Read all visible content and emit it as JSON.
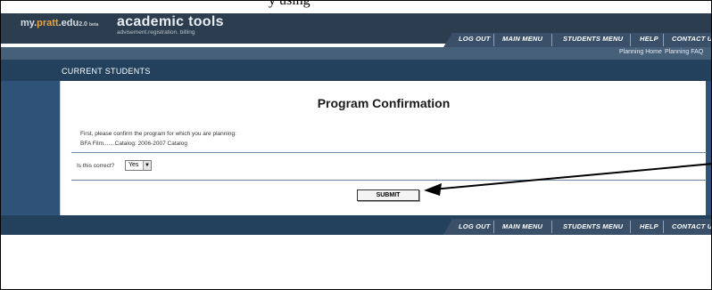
{
  "caption_fragment": "y using",
  "header": {
    "brand_my": "my.",
    "brand_pratt": "pratt",
    "brand_edu": ".edu",
    "brand_version": "2.0",
    "brand_beta": "beta",
    "app_title": "academic tools",
    "app_subtitle": "advisement.registration. billing"
  },
  "nav": {
    "items": [
      {
        "label": "LOG OUT"
      },
      {
        "label": "MAIN MENU"
      },
      {
        "label": "STUDENTS MENU"
      },
      {
        "label": "HELP"
      },
      {
        "label": "CONTACT US"
      }
    ]
  },
  "subnav": {
    "links": [
      {
        "label": "Planning Home"
      },
      {
        "label": "Planning FAQ"
      }
    ]
  },
  "section": {
    "title": "CURRENT STUDENTS"
  },
  "main": {
    "heading": "Program Confirmation",
    "instruction": "First, please confirm the program for which you are planning:",
    "program_line": "BFA Film.......Catalog: 2006-2007 Catalog",
    "confirm_label": "Is this correct?",
    "confirm_select": {
      "selected": "Yes",
      "options": [
        "Yes"
      ]
    },
    "submit_label": "SUBMIT"
  },
  "colors": {
    "top_bar": "#2b3d4f",
    "nav_bar": "#3a5068",
    "section_bar": "#23415d",
    "side_panel": "#2e5278",
    "brand_accent": "#e5a33b"
  }
}
